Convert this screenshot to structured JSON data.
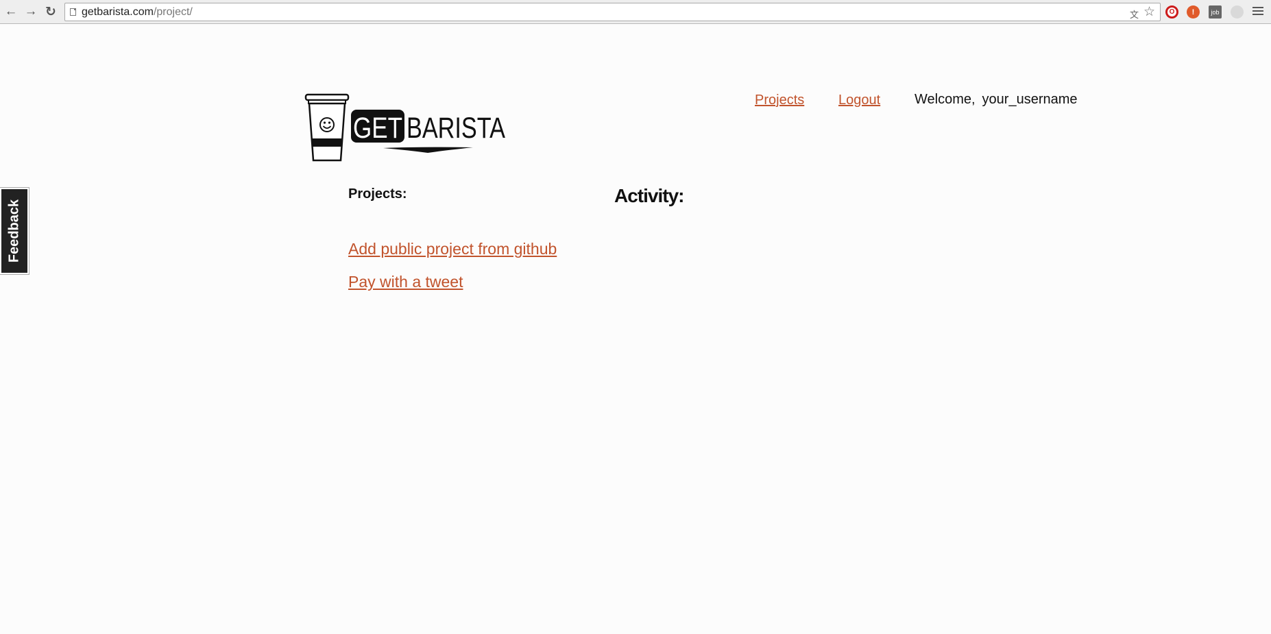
{
  "browser": {
    "url_domain": "getbarista.com",
    "url_path": "/project/",
    "back_glyph": "←",
    "forward_glyph": "→",
    "reload_glyph": "↻",
    "bookmark_glyph": "☆",
    "translate_glyph": "文",
    "extensions": [
      {
        "name": "opera-icon",
        "glyph": "O",
        "color": "#cc1b1b"
      },
      {
        "name": "alert-icon",
        "glyph": "!",
        "color": "#e05a2a"
      },
      {
        "name": "job-icon",
        "glyph": "job",
        "color": "#666666"
      },
      {
        "name": "extension-icon",
        "glyph": "",
        "color": "#cccccc"
      }
    ]
  },
  "header": {
    "logo_text_get": "GET",
    "logo_text_barista": "BARISTA",
    "nav": [
      {
        "label": "Projects"
      },
      {
        "label": "Logout"
      }
    ],
    "welcome_label": "Welcome,",
    "username": "your_username"
  },
  "main": {
    "projects_heading": "Projects:",
    "activity_heading": "Activity:",
    "links": [
      {
        "label": "Add public project from github"
      },
      {
        "label": "Pay with a tweet"
      }
    ]
  },
  "feedback": {
    "label": "Feedback"
  },
  "colors": {
    "link": "#c1532c",
    "page_background": "#fcfcfc"
  }
}
